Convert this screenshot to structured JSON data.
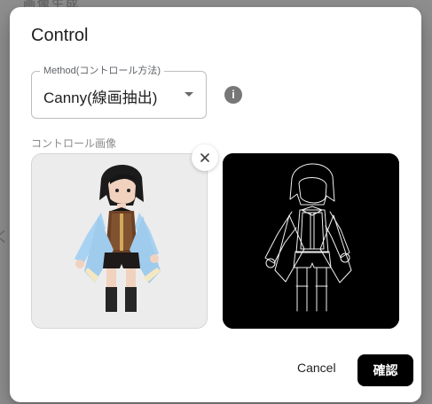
{
  "backdrop": {
    "top_text": "画像生成",
    "left_text": "く"
  },
  "dialog": {
    "title": "Control",
    "method_label": "Method(コントロール方法)",
    "method_value": "Canny(線画抽出)",
    "info_icon": "info-icon",
    "image_section_label": "コントロール画像",
    "close_icon": "close-icon",
    "cancel_label": "Cancel",
    "confirm_label": "確認"
  }
}
